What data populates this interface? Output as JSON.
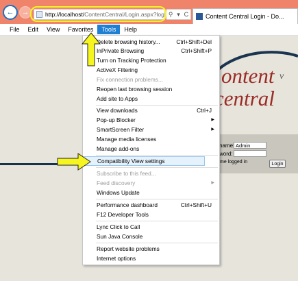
{
  "browser": {
    "url_host": "http://localhost/",
    "url_rest": "ContentCentral/Login.aspx?loginRed",
    "tab_title": "Content Central Login - Do...",
    "addr_search_glyph": "⚲",
    "addr_dropdown_glyph": "▾",
    "addr_refresh_glyph": "C",
    "back_glyph": "←",
    "forward_glyph": "→"
  },
  "menubar": {
    "items": [
      "File",
      "Edit",
      "View",
      "Favorites",
      "Tools",
      "Help"
    ],
    "active": "Tools"
  },
  "tools_menu": {
    "items": [
      {
        "label": "Delete browsing history...",
        "shortcut": "Ctrl+Shift+Del"
      },
      {
        "label": "InPrivate Browsing",
        "shortcut": "Ctrl+Shift+P"
      },
      {
        "label": "Turn on Tracking Protection",
        "shortcut": ""
      },
      {
        "label": "ActiveX Filtering",
        "shortcut": ""
      },
      {
        "label": "Fix connection problems...",
        "shortcut": "",
        "disabled": true
      },
      {
        "label": "Reopen last browsing session",
        "shortcut": ""
      },
      {
        "label": "Add site to Apps",
        "shortcut": ""
      },
      {
        "label": "View downloads",
        "shortcut": "Ctrl+J"
      },
      {
        "label": "Pop-up Blocker",
        "shortcut": "",
        "submenu": true
      },
      {
        "label": "SmartScreen Filter",
        "shortcut": "",
        "submenu": true
      },
      {
        "label": "Manage media licenses",
        "shortcut": ""
      },
      {
        "label": "Manage add-ons",
        "shortcut": ""
      },
      {
        "label": "Compatibility View settings",
        "shortcut": "",
        "highlighted": true
      },
      {
        "label": "Subscribe to this feed...",
        "shortcut": "",
        "disabled": true
      },
      {
        "label": "Feed discovery",
        "shortcut": "",
        "disabled": true,
        "submenu": true
      },
      {
        "label": "Windows Update",
        "shortcut": ""
      },
      {
        "label": "Performance dashboard",
        "shortcut": "Ctrl+Shift+U"
      },
      {
        "label": "F12 Developer Tools",
        "shortcut": ""
      },
      {
        "label": "Lync Click to Call",
        "shortcut": ""
      },
      {
        "label": "Sun Java Console",
        "shortcut": ""
      },
      {
        "label": "Report website problems",
        "shortcut": ""
      },
      {
        "label": "Internet options",
        "shortcut": ""
      }
    ],
    "submenu_glyph": "▶"
  },
  "page": {
    "logo_word1": "ontent",
    "logo_word2": "central",
    "logo_suffix": "v",
    "username_label": "name:",
    "username_value": "Admin",
    "password_label": "word:",
    "remember_label": "me logged in",
    "login_button": "Login"
  },
  "colors": {
    "titlebar": "#f0846b",
    "menu_active": "#1e7fd3",
    "highlight_arrow": "#f7f51f",
    "logo": "#9a2b26"
  }
}
